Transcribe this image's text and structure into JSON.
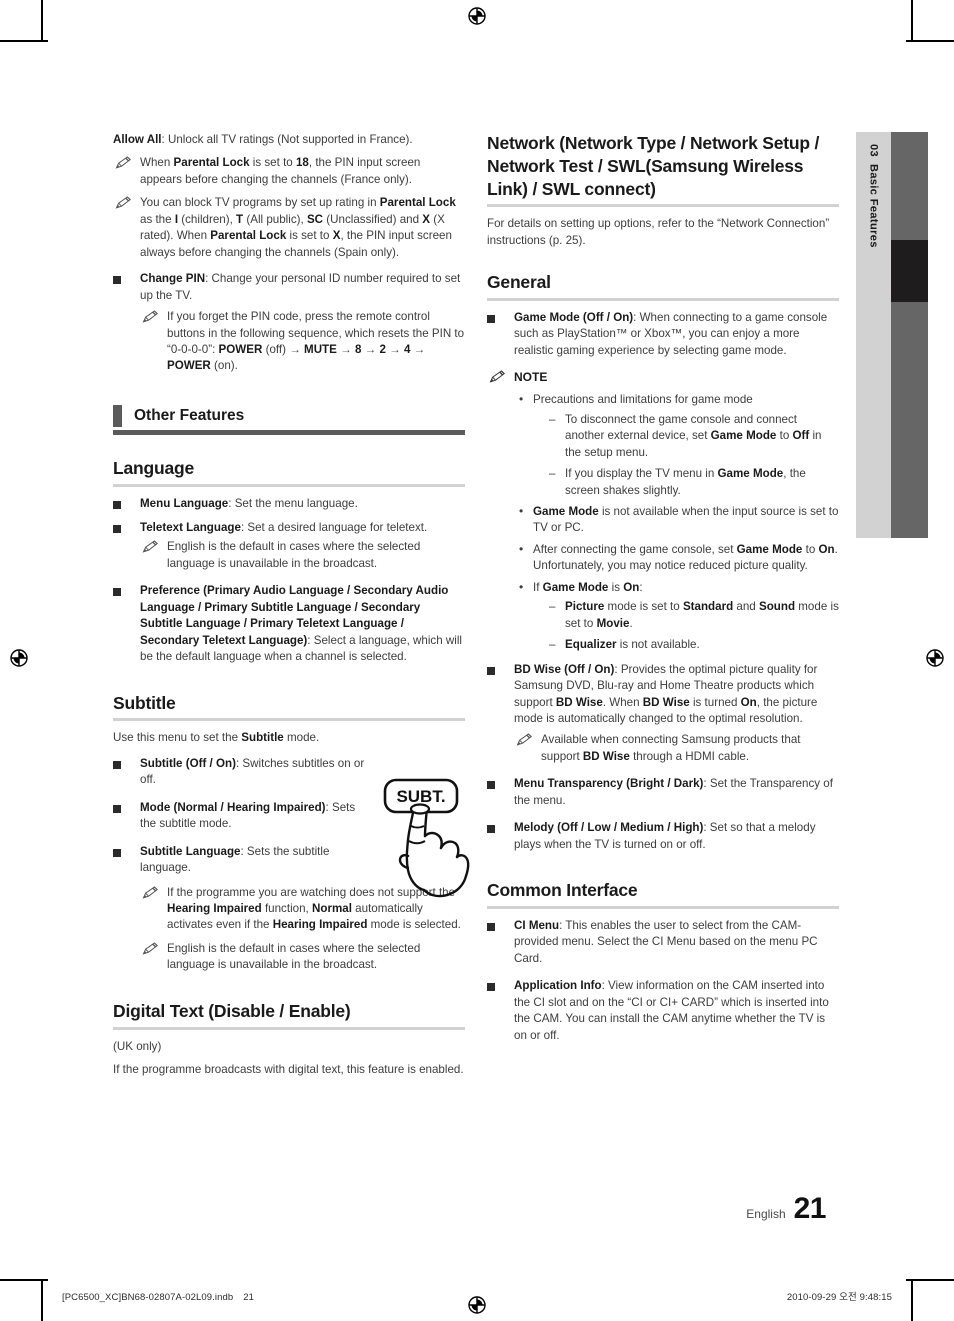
{
  "page": {
    "number": "21",
    "language_label": "English",
    "side_tab": {
      "chapter_number": "03",
      "chapter_title": "Basic Features"
    },
    "imprint_file": "[PC6500_XC]BN68-02807A-02L09.indb",
    "imprint_page": "21",
    "timestamp": "2010-09-29   오전 9:48:15"
  },
  "colors": {
    "tab_light": "#d2d2d2",
    "tab_dark": "#666666",
    "tab_black": "#1e1c1c",
    "rule_light": "#d2d2d2",
    "rule_dark": "#5b5b5b",
    "bullet": "#2b2b2b",
    "body_text": "#3d3d3d",
    "heading_text": "#1a1a1a"
  },
  "left_column": {
    "allow_all": {
      "term": "Allow All",
      "text": ": Unlock all TV ratings (Not supported in France)."
    },
    "allow_all_notes": [
      "When <b>Parental Lock</b> is set to <b>18</b>, the PIN input screen appears before changing the channels (France only).",
      "You can block TV programs by set up rating in <b>Parental Lock</b> as the <b>I</b> (children), <b>T</b> (All public), <b>SC</b> (Unclassified) and <b>X</b> (X rated). When <b>Parental Lock</b> is set to <b>X</b>, the PIN input screen always before changing the channels (Spain only)."
    ],
    "change_pin": {
      "term": "Change PIN",
      "text": ": Change your personal ID number required to set up the TV.",
      "note": "If you forget the PIN code, press the remote control buttons in the following sequence, which resets the PIN to “0-0-0-0”: <b>POWER</b> (off) → <b>MUTE</b> → <b>8</b> → <b>2</b> → <b>4</b> → <b>POWER</b> (on)."
    },
    "other_features_banner": "Other Features",
    "language": {
      "heading": "Language",
      "items": [
        {
          "html": "<b>Menu Language</b>: Set the menu language."
        },
        {
          "html": "<b>Teletext Language</b>: Set a desired language for teletext.",
          "note": "English is the default in cases where the selected language is unavailable in the broadcast."
        },
        {
          "html": "<b>Preference (Primary Audio Language / Secondary Audio Language / Primary Subtitle Language / Secondary Subtitle Language / Primary Teletext Language / Secondary Teletext Language)</b>: Select a language, which will be the default language when a channel is selected."
        }
      ]
    },
    "subtitle": {
      "heading": "Subtitle",
      "intro": "Use this menu to set the <b>Subtitle</b> mode.",
      "items": [
        {
          "html": "<b>Subtitle (Off / On)</b>: Switches subtitles on or off."
        },
        {
          "html": "<b>Mode (Normal / Hearing Impaired)</b>: Sets the subtitle mode."
        },
        {
          "html": "<b>Subtitle Language</b>: Sets the subtitle language."
        }
      ],
      "notes": [
        "If the programme you are watching does not support the <b>Hearing Impaired</b> function, <b>Normal</b> automatically activates even if the <b>Hearing Impaired</b> mode is selected.",
        "English is the default in cases where the selected language is unavailable in the broadcast."
      ],
      "button_illustration_label": "SUBT."
    },
    "digital_text": {
      "heading": "Digital Text (Disable / Enable)",
      "paragraphs": [
        "(UK only)",
        "If the programme broadcasts with digital text, this feature is enabled."
      ]
    }
  },
  "right_column": {
    "network": {
      "heading": "Network (Network Type / Network Setup / Network Test / SWL(Samsung Wireless Link) / SWL connect)",
      "paragraph": "For details on setting up options, refer to the “Network Connection” instructions (p. 25)."
    },
    "general": {
      "heading": "General",
      "game_mode": {
        "html": "<b>Game Mode (Off / On)</b>: When connecting to a game console such as PlayStation™ or Xbox™, you can enjoy a more realistic gaming experience by selecting game mode."
      },
      "note_label": "NOTE",
      "notes": [
        {
          "html": "Precautions and limitations for game mode",
          "sub": [
            "To disconnect the game console and connect another external device, set <b>Game Mode</b> to <b>Off</b> in the setup menu.",
            "If you display the TV menu in <b>Game Mode</b>, the screen shakes slightly."
          ]
        },
        {
          "html": "<b>Game Mode</b> is not available when the input source is set to TV or PC.",
          "sub": []
        },
        {
          "html": "After connecting the game console, set <b>Game Mode</b> to <b>On</b>. Unfortunately, you may notice reduced picture quality.",
          "sub": []
        },
        {
          "html": "If <b>Game Mode</b> is <b>On</b>:",
          "sub": [
            "<b>Picture</b> mode is set to <b>Standard</b> and <b>Sound</b> mode is set to <b>Movie</b>.",
            "<b>Equalizer</b> is not available."
          ]
        }
      ],
      "bd_wise": {
        "html": "<b>BD Wise (Off / On)</b>: Provides the optimal picture quality for Samsung DVD, Blu-ray and Home Theatre products which support <b>BD Wise</b>. When <b>BD Wise</b> is turned <b>On</b>, the picture mode is automatically changed to the optimal resolution.",
        "note": "Available when connecting Samsung products that support <b>BD Wise</b> through a HDMI cable."
      },
      "menu_transparency": {
        "html": "<b>Menu Transparency (Bright / Dark)</b>: Set the Transparency of the menu."
      },
      "melody": {
        "html": "<b>Melody (Off / Low / Medium / High)</b>: Set so that a melody plays when the TV is turned on or off."
      }
    },
    "common_interface": {
      "heading": "Common Interface",
      "items": [
        {
          "html": "<b>CI Menu</b>: This enables the user to select from the CAM-provided menu. Select the CI Menu based on the menu PC Card."
        },
        {
          "html": "<b>Application Info</b>: View information on the CAM inserted into the CI slot and on the “CI or CI+ CARD” which is inserted into the CAM. You can install the CAM anytime whether the TV is on or off."
        }
      ]
    }
  }
}
